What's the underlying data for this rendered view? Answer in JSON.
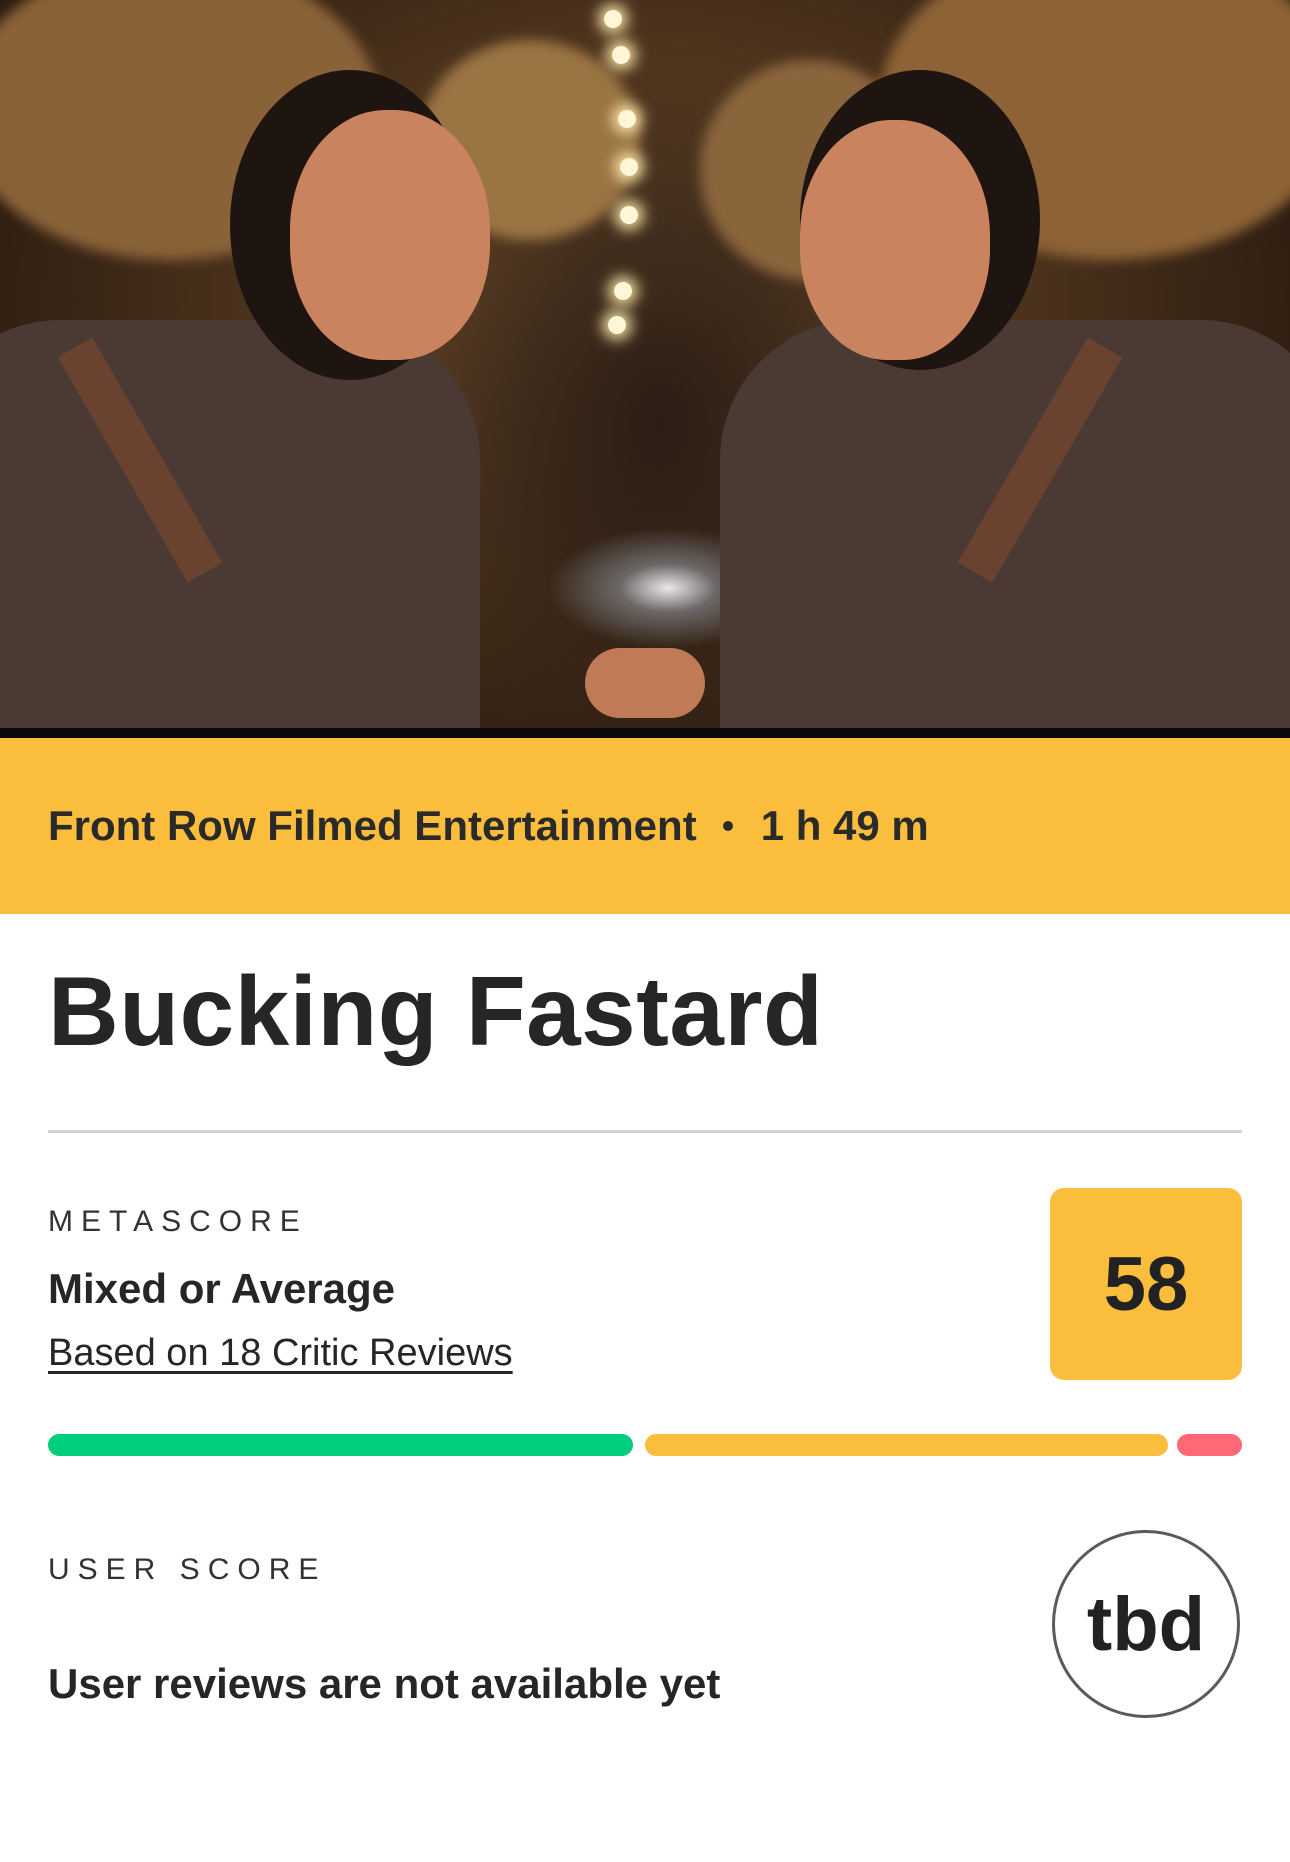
{
  "hero": {
    "image_description_icon": "movie-still-image"
  },
  "info_bar": {
    "studio": "Front Row Filmed Entertainment",
    "runtime": "1 h 49 m"
  },
  "title": "Bucking Fastard",
  "metascore": {
    "label": "METASCORE",
    "verdict": "Mixed or Average",
    "reviews_link": "Based on 18 Critic Reviews",
    "score": "58",
    "score_color": "#fbbe3c",
    "distribution": {
      "positive_fraction": 0.49,
      "mixed_fraction": 0.44,
      "negative_fraction": 0.06,
      "positive_color": "#00ce7a",
      "mixed_color": "#fbbe3c",
      "negative_color": "#ff6874"
    }
  },
  "user_score": {
    "label": "USER SCORE",
    "message": "User reviews are not available yet",
    "score": "tbd"
  }
}
